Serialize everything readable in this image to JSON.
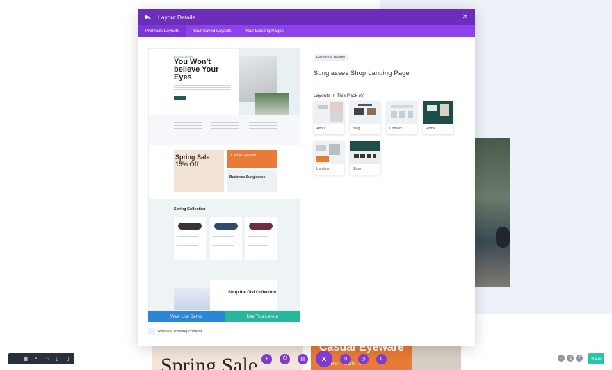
{
  "modal": {
    "title": "Layout Details",
    "tabs": [
      {
        "label": "Premade Layouts",
        "active": true
      },
      {
        "label": "Your Saved Layouts",
        "active": false
      },
      {
        "label": "Your Existing Pages",
        "active": false
      }
    ]
  },
  "preview": {
    "hero_tag": "FULL COLLECTION",
    "hero_heading": "You Won't believe Your Eyes",
    "sale_text": "Spring Sale 15% Off",
    "orange_text": "Casual Eyewear",
    "business_text": "Business Sunglasses",
    "collection_heading": "Spring Collection",
    "products": [
      "Blooms",
      "Elvis",
      "Monarchs"
    ],
    "shop_heading": "Shop the Divi Collection",
    "view_demo_label": "View Live Demo",
    "use_layout_label": "Use This Layout"
  },
  "replace_label": "Replace existing content",
  "details": {
    "category": "Fashion & Beauty",
    "layout_name": "Sunglasses Shop Landing Page",
    "description": ".",
    "pack_title": "Layouts In This Pack (6)",
    "layouts": [
      {
        "label": "About"
      },
      {
        "label": "Blog"
      },
      {
        "label": "Contact"
      },
      {
        "label": "Home"
      },
      {
        "label": "Landing"
      },
      {
        "label": "Shop"
      }
    ]
  },
  "background": {
    "hero_left_text": "Spring Sale",
    "hero_right_title": "Casual Eyeware",
    "hero_right_cta": "SHOP NOW →"
  },
  "toolbar": {
    "save_label": "Save",
    "left_icons": [
      "more-icon",
      "wireframe-icon",
      "zoom-icon",
      "desktop-icon",
      "tablet-icon",
      "phone-icon"
    ],
    "center_icons": [
      "add-icon",
      "power-icon",
      "trash-icon",
      "close-icon",
      "settings-icon",
      "history-icon",
      "sort-icon"
    ],
    "right_icons": [
      "search-icon",
      "portability-icon",
      "help-icon"
    ]
  },
  "colors": {
    "header_purple": "#6c2eb9",
    "tab_purple": "#8f42ec",
    "demo_blue": "#2b86d6",
    "use_green": "#27b79c",
    "save_green": "#29c4a9"
  }
}
